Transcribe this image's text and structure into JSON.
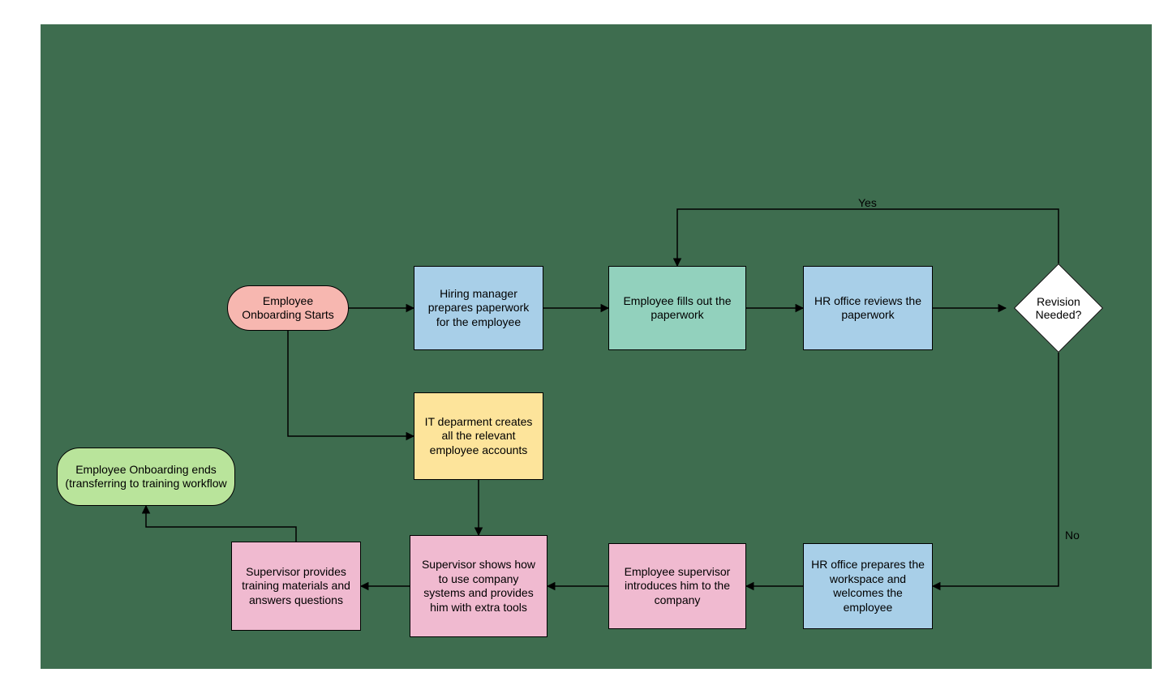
{
  "colors": {
    "canvas": "#3e6d4f",
    "start": "#f7b7b0",
    "end": "#b9e49b",
    "blue": "#a8cfe8",
    "teal": "#92d1bd",
    "yellow": "#fde49b",
    "pink": "#f0bad0",
    "decisionFill": "#ffffff",
    "stroke": "#000000"
  },
  "nodes": {
    "start": {
      "label": "Employee Onboarding Starts"
    },
    "hiring": {
      "label": "Hiring manager prepares paperwork for the employee"
    },
    "fills": {
      "label": "Employee fills out the paperwork"
    },
    "review": {
      "label": "HR office reviews the paperwork"
    },
    "decision": {
      "label": "Revision Needed?"
    },
    "it": {
      "label": "IT deparment creates all the relevant employee accounts"
    },
    "hrprepare": {
      "label": "HR office prepares the workspace and welcomes the employee"
    },
    "supintro": {
      "label": "Employee supervisor introduces him to the company"
    },
    "supshow": {
      "label": "Supervisor shows how to use company systems and provides him with extra tools"
    },
    "suptrain": {
      "label": "Supervisor provides training materials and answers questions"
    },
    "end": {
      "label": "Employee Onboarding ends (transferring to training workflow"
    }
  },
  "edgeLabels": {
    "yes": "Yes",
    "no": "No"
  }
}
